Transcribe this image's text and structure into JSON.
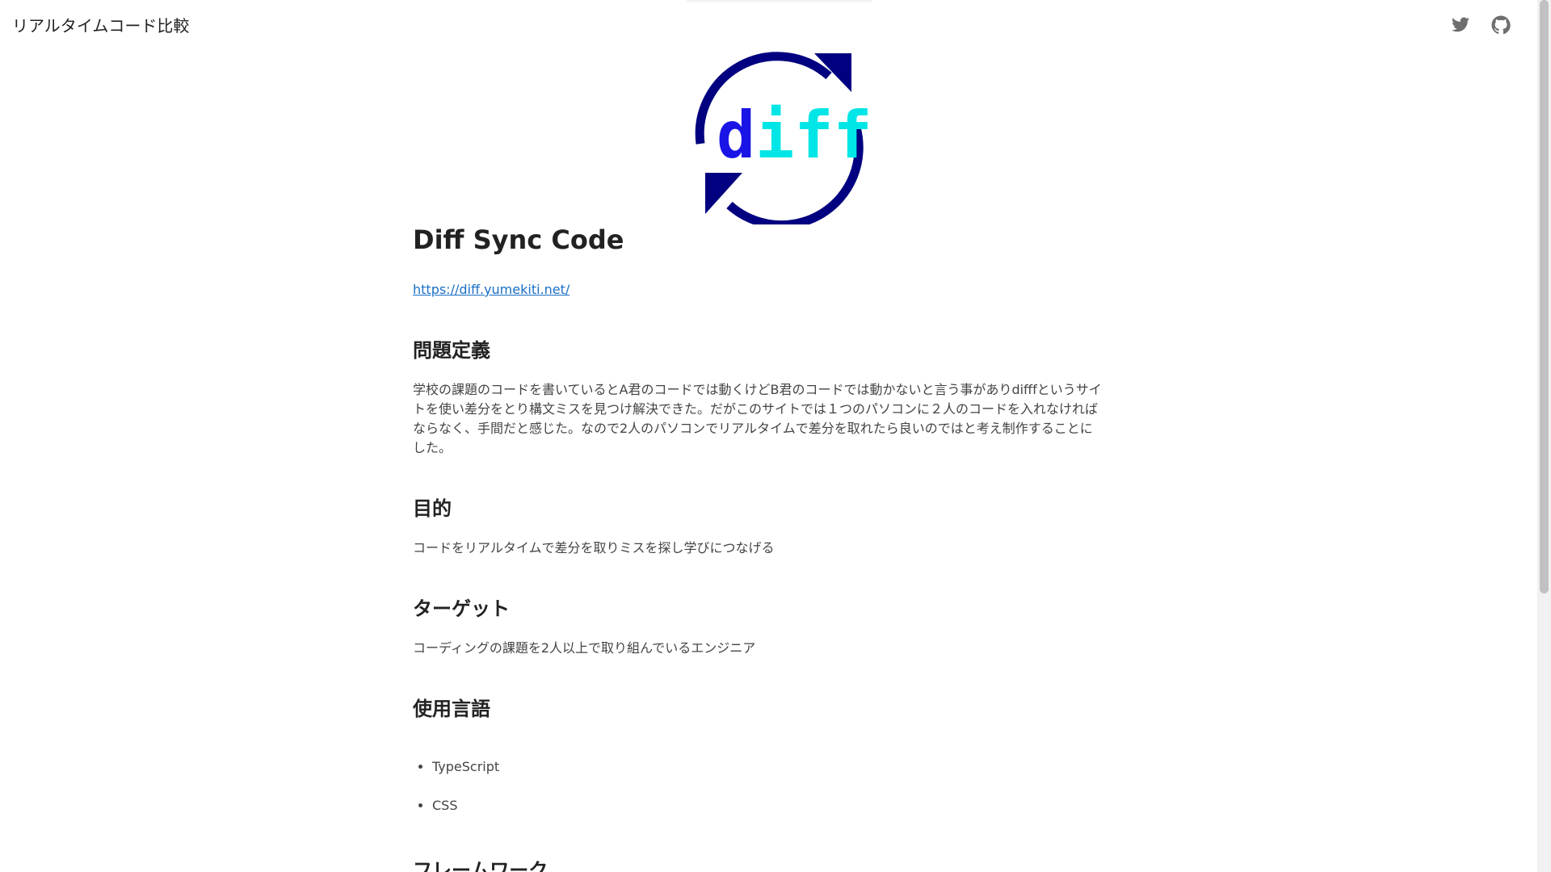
{
  "header": {
    "site_title": "リアルタイムコード比較",
    "icons": [
      "twitter-icon",
      "github-icon"
    ]
  },
  "logo": {
    "text": "diff",
    "colors": {
      "ring": "#000080",
      "d": "#1a14e6",
      "iff": "#00e5e5"
    }
  },
  "article": {
    "title": "Diff Sync Code",
    "link": "https://diff.yumekiti.net/",
    "sections": [
      {
        "heading": "問題定義",
        "body": "学校の課題のコードを書いているとA君のコードでは動くけどB君のコードでは動かないと言う事がありdifffというサイトを使い差分をとり構文ミスを見つけ解決できた。だがこのサイトでは１つのパソコンに２人のコードを入れなければならなく、手間だと感じた。なので2人のパソコンでリアルタイムで差分を取れたら良いのではと考え制作することにした。"
      },
      {
        "heading": "目的",
        "body": "コードをリアルタイムで差分を取りミスを探し学びにつなげる"
      },
      {
        "heading": "ターゲット",
        "body": "コーディングの課題を2人以上で取り組んでいるエンジニア"
      },
      {
        "heading": "使用言語",
        "items": [
          "TypeScript",
          "CSS"
        ]
      },
      {
        "heading": "フレームワーク"
      }
    ]
  },
  "colors": {
    "link": "#1a6fc4",
    "text": "#222222",
    "icon": "#6e6e6e"
  }
}
